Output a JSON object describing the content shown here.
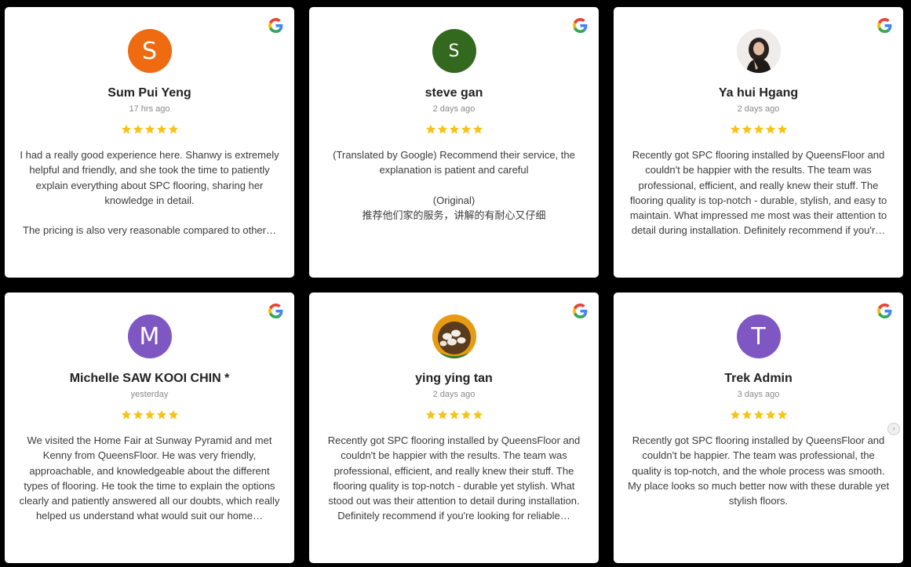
{
  "colors": {
    "star": "#f7c31b",
    "avatar_s1": "#ee6b11",
    "avatar_s2": "#33691e",
    "avatar_m": "#7e57c2",
    "avatar_t": "#7e57c2"
  },
  "reviews": [
    {
      "initial": "S",
      "name": "Sum Pui Yeng",
      "time": "17 hrs ago",
      "paragraphs": [
        "I had a really good experience here. Shanwy is extremely helpful and friendly, and she took the time to patiently explain everything about SPC flooring, sharing her knowledge in detail.",
        "The pricing is also very reasonable compared to other…"
      ]
    },
    {
      "initial": "S",
      "name": "steve gan",
      "time": "2 days ago",
      "paragraphs": [
        "(Translated by Google) Recommend their service, the explanation is patient and careful",
        "(Original)",
        "推荐他们家的服务，讲解的有耐心又仔细"
      ]
    },
    {
      "initial": "",
      "name": "Ya hui Hgang",
      "time": "2 days ago",
      "paragraphs": [
        "Recently got SPC flooring installed by QueensFloor and couldn't be happier with the results. The team was professional, efficient, and really knew their stuff. The flooring quality is top-notch - durable, stylish, and easy to maintain. What impressed me most was their attention to detail during installation. Definitely recommend if you'r…"
      ]
    },
    {
      "initial": "M",
      "name": "Michelle SAW KOOI CHIN *",
      "time": "yesterday",
      "paragraphs": [
        "We visited the Home Fair at Sunway Pyramid and met Kenny from QueensFloor. He was very friendly, approachable, and knowledgeable about the different types of flooring. He took the time to explain the options clearly and patiently answered all our doubts, which really helped us understand what would suit our home…"
      ]
    },
    {
      "initial": "",
      "name": "ying ying tan",
      "time": "2 days ago",
      "paragraphs": [
        "Recently got SPC flooring installed by QueensFloor and couldn't be happier with the results. The team was professional, efficient, and really knew their stuff. The flooring quality is top-notch - durable yet stylish. What stood out was their attention to detail during installation. Definitely recommend if you're looking for reliable…"
      ]
    },
    {
      "initial": "T",
      "name": "Trek Admin",
      "time": "3 days ago",
      "paragraphs": [
        "Recently got SPC flooring installed by QueensFloor and couldn't be happier. The team was professional, the quality is top-notch, and the whole process was smooth. My place looks so much better now with these durable yet stylish floors."
      ]
    }
  ]
}
